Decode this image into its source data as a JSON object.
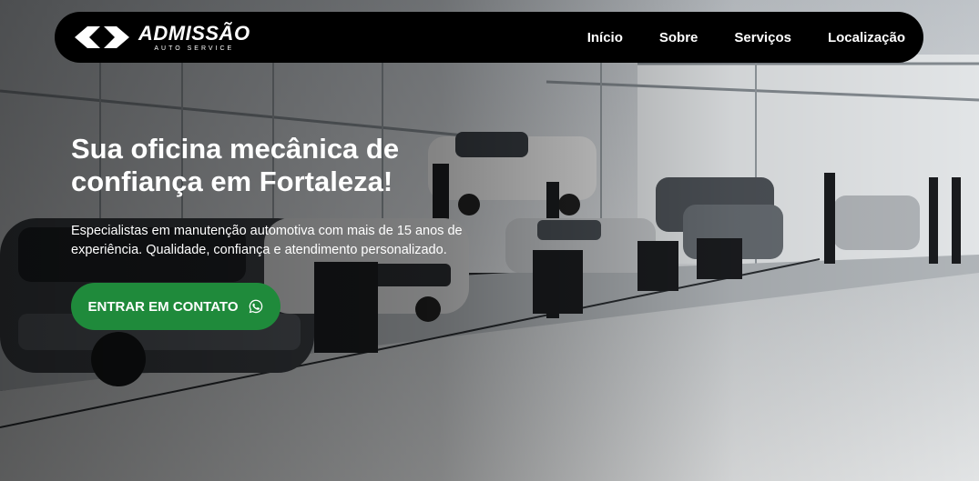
{
  "brand": {
    "name": "ADMISSÃO",
    "tagline": "AUTO SERVICE",
    "logo_icon": "admissao-logo-icon"
  },
  "nav": {
    "items": [
      {
        "label": "Início"
      },
      {
        "label": "Sobre"
      },
      {
        "label": "Serviços"
      },
      {
        "label": "Localização"
      }
    ]
  },
  "hero": {
    "headline": "Sua oficina mecânica de confiança em Fortaleza!",
    "description": "Especialistas em manutenção automotiva com mais de 15 anos de experiência. Qualidade, confiança e atendimento personalizado.",
    "cta_label": "ENTRAR EM CONTATO",
    "cta_icon": "whatsapp-icon"
  },
  "colors": {
    "navbar_bg": "#000000",
    "cta_bg": "#1f8a3b",
    "text": "#ffffff"
  }
}
